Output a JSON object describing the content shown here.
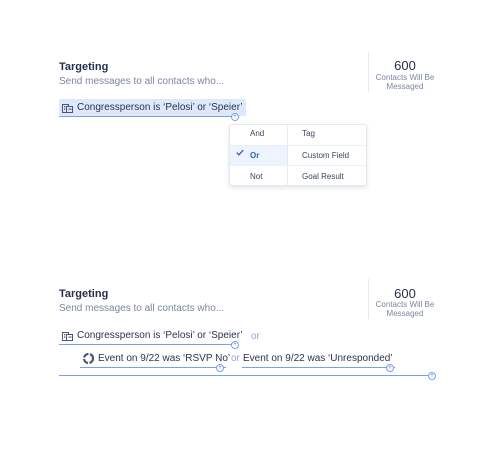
{
  "panel1": {
    "title": "Targeting",
    "subtitle": "Send messages to all contacts who...",
    "count_value": "600",
    "count_label_line1": "Contacts Will Be",
    "count_label_line2": "Messaged",
    "chip_label": "Congressperson is ‘Pelosi’ or ‘Speier’",
    "chip_icon": "building-icon",
    "menu": {
      "logic_items": [
        "And",
        "Or",
        "Not"
      ],
      "selected_logic": "Or",
      "type_items": [
        "Tag",
        "Custom Field",
        "Goal Result"
      ]
    }
  },
  "panel2": {
    "title": "Targeting",
    "subtitle": "Send messages to all contacts who...",
    "count_value": "600",
    "count_label_line1": "Contacts Will Be",
    "count_label_line2": "Messaged",
    "chip_label": "Congressperson is ‘Pelosi’ or ‘Speier’",
    "chip_icon": "building-icon",
    "or_label": "or",
    "event_chip1": "Event on 9/22 was ‘RSVP No’",
    "event_icon": "event-icon",
    "event_or_label": "or",
    "event_chip2": "Event on 9/22 was ‘Unresponded’"
  },
  "colors": {
    "accent": "#5b87d6",
    "chip_highlight": "#dce9fb",
    "text_primary": "#26304d",
    "text_muted": "#7c86a2"
  }
}
